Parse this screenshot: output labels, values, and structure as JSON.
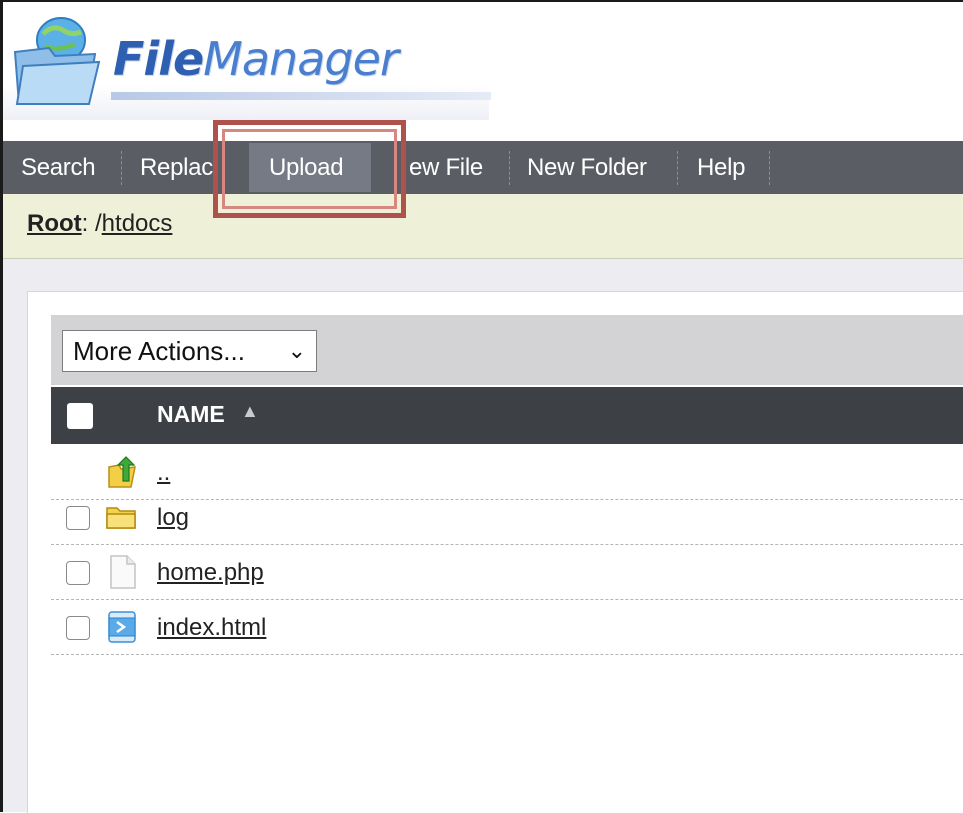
{
  "app": {
    "logo_bold": "File",
    "logo_rest": "Manager"
  },
  "nav": {
    "items": [
      "Search",
      "Replac",
      "Upload",
      "ew File",
      "New Folder",
      "Help"
    ],
    "active": "Upload"
  },
  "breadcrumb": {
    "root": "Root",
    "sep": ": /",
    "path": "htdocs"
  },
  "actions": {
    "more_actions": "More Actions...",
    "chevron": "⌄"
  },
  "table": {
    "header_name": "NAME",
    "sort_glyph": "▲",
    "rows": [
      {
        "name": "..",
        "icon": "folder-up-icon",
        "has_checkbox": false
      },
      {
        "name": "log",
        "icon": "folder-icon",
        "has_checkbox": true
      },
      {
        "name": "home.php",
        "icon": "file-icon",
        "has_checkbox": true
      },
      {
        "name": "index.html",
        "icon": "html-file-icon",
        "has_checkbox": true
      }
    ]
  },
  "colors": {
    "navbar": "#5a5e64",
    "nav_active": "#767a84",
    "breadcrumb_bg": "#eef1d8",
    "table_header": "#3d4045",
    "highlight": "#b0524c",
    "logo_blue": "#3b6fbf"
  }
}
